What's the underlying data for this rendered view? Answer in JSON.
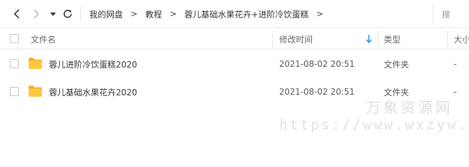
{
  "nav": {
    "back_icon": "chevron-left-icon",
    "forward_icon": "chevron-right-icon",
    "history_icon": "caret-down-icon",
    "refresh_icon": "refresh-icon"
  },
  "breadcrumb": {
    "items": [
      "我的网盘",
      "教程",
      "蓉儿基础水果花卉+进阶冷饮蛋糕"
    ],
    "separator": ">"
  },
  "search": {
    "placeholder": "搜"
  },
  "columns": {
    "name": "文件名",
    "modified": "修改时间",
    "type": "类型",
    "size": "大小"
  },
  "files": [
    {
      "name": "蓉儿进阶冷饮蛋糕2020",
      "modified": "2021-08-02 20:51",
      "type": "文件夹",
      "size": "-"
    },
    {
      "name": "蓉儿基础水果花卉2020",
      "modified": "2021-08-02 20:51",
      "type": "文件夹",
      "size": "-"
    }
  ],
  "colors": {
    "folder": "#ffc83d",
    "folder_tab": "#f0b429",
    "accent": "#1a8cff",
    "border": "#e9e9e9"
  },
  "watermark": {
    "title": "万象资源网",
    "url": "https://www.wxzyw.cn"
  }
}
